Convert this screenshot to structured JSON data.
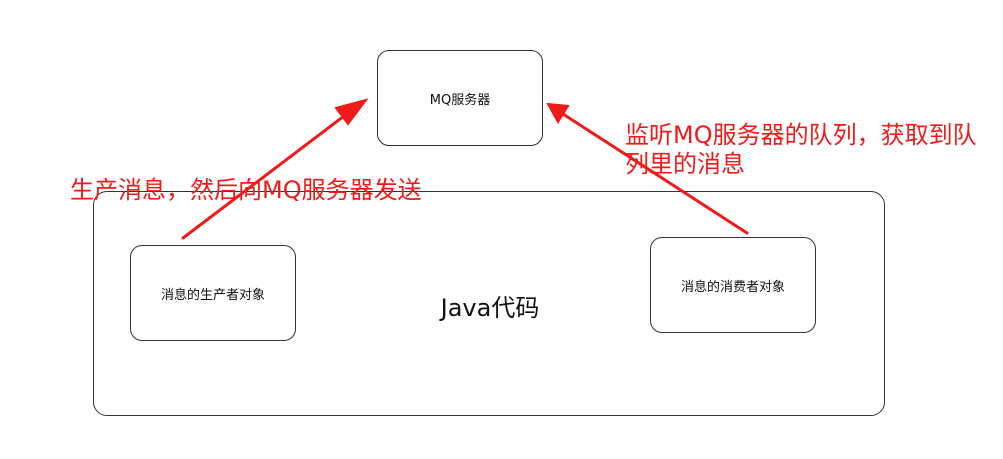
{
  "diagram": {
    "mq_server": {
      "label": "MQ服务器"
    },
    "java_container": {
      "label": "Java代码"
    },
    "producer": {
      "label": "消息的生产者对象"
    },
    "consumer": {
      "label": "消息的消费者对象"
    },
    "annotations": {
      "produce": "生产消息，然后向MQ服务器发送",
      "listen": "监听MQ服务器的队列，获取到队列里的消息"
    },
    "colors": {
      "arrow": "#f01a1a",
      "annotation_text": "#f01a1a",
      "box_border": "#333333"
    }
  }
}
